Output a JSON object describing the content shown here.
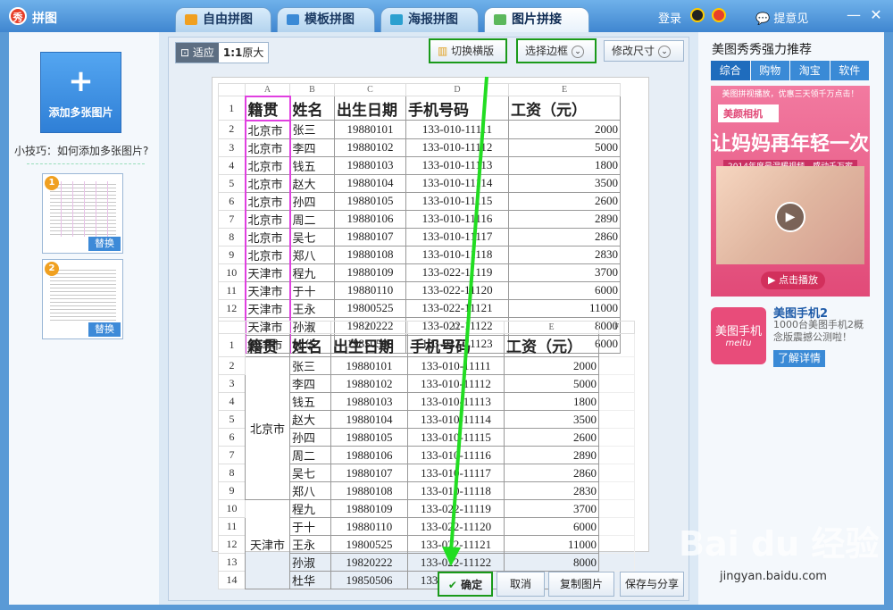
{
  "window": {
    "logo_text": "秀",
    "title": "拼图",
    "login": "登录",
    "feedback": "提意见",
    "minimize": "—",
    "close": "✕"
  },
  "tabs": [
    {
      "label": "自由拼图",
      "color": "#f0a020"
    },
    {
      "label": "模板拼图",
      "color": "#3a8ad6"
    },
    {
      "label": "海报拼图",
      "color": "#2aa0d0"
    },
    {
      "label": "图片拼接",
      "color": "#5cb85c"
    }
  ],
  "left": {
    "add_label": "添加多张图片",
    "plus": "+",
    "tip": "小技巧：如何添加多张图片?",
    "thumbs": [
      {
        "num": "1",
        "replace": "替换"
      },
      {
        "num": "2",
        "replace": "替换"
      }
    ]
  },
  "toolbar": {
    "fit": "适应",
    "ratio": "1:1",
    "original": "原大",
    "switch_layout": "切换横版",
    "select_border": "选择边框",
    "resize": "修改尺寸"
  },
  "sheet1": {
    "col_headers": [
      "A",
      "B",
      "C",
      "D",
      "E"
    ],
    "headers": [
      "籍贯",
      "姓名",
      "出生日期",
      "手机号码",
      "工资（元）"
    ],
    "rows": [
      [
        "2",
        "北京市",
        "张三",
        "19880101",
        "133-010-11111",
        "2000"
      ],
      [
        "3",
        "北京市",
        "李四",
        "19880102",
        "133-010-11112",
        "5000"
      ],
      [
        "4",
        "北京市",
        "钱五",
        "19880103",
        "133-010-11113",
        "1800"
      ],
      [
        "5",
        "北京市",
        "赵大",
        "19880104",
        "133-010-11114",
        "3500"
      ],
      [
        "6",
        "北京市",
        "孙四",
        "19880105",
        "133-010-11115",
        "2600"
      ],
      [
        "7",
        "北京市",
        "周二",
        "19880106",
        "133-010-11116",
        "2890"
      ],
      [
        "8",
        "北京市",
        "吴七",
        "19880107",
        "133-010-11117",
        "2860"
      ],
      [
        "9",
        "北京市",
        "郑八",
        "19880108",
        "133-010-11118",
        "2830"
      ],
      [
        "10",
        "天津市",
        "程九",
        "19880109",
        "133-022-11119",
        "3700"
      ],
      [
        "11",
        "天津市",
        "于十",
        "19880110",
        "133-022-11120",
        "6000"
      ],
      [
        "12",
        "天津市",
        "王永",
        "19800525",
        "133-022-11121",
        "11000"
      ],
      [
        "13",
        "天津市",
        "孙淑",
        "19820222",
        "133-022-11122",
        "8000"
      ],
      [
        "14",
        "天津市",
        "杜华",
        "19850506",
        "133-022-11123",
        "6000"
      ]
    ]
  },
  "sheet2": {
    "col_headers": [
      "A",
      "B",
      "C",
      "D",
      "E",
      "F"
    ],
    "headers": [
      "籍贯",
      "姓名",
      "出生日期",
      "手机号码",
      "工资（元）"
    ],
    "groups": [
      "北京市",
      "天津市"
    ],
    "rows": [
      [
        "2",
        "张三",
        "19880101",
        "133-010-11111",
        "2000"
      ],
      [
        "3",
        "李四",
        "19880102",
        "133-010-11112",
        "5000"
      ],
      [
        "4",
        "钱五",
        "19880103",
        "133-010-11113",
        "1800"
      ],
      [
        "5",
        "赵大",
        "19880104",
        "133-010-11114",
        "3500"
      ],
      [
        "6",
        "孙四",
        "19880105",
        "133-010-11115",
        "2600"
      ],
      [
        "7",
        "周二",
        "19880106",
        "133-010-11116",
        "2890"
      ],
      [
        "8",
        "吴七",
        "19880107",
        "133-010-11117",
        "2860"
      ],
      [
        "9",
        "郑八",
        "19880108",
        "133-010-11118",
        "2830"
      ],
      [
        "10",
        "程九",
        "19880109",
        "133-022-11119",
        "3700"
      ],
      [
        "11",
        "于十",
        "19880110",
        "133-022-11120",
        "6000"
      ],
      [
        "12",
        "王永",
        "19800525",
        "133-022-11121",
        "11000"
      ],
      [
        "13",
        "孙淑",
        "19820222",
        "133-022-11122",
        "8000"
      ],
      [
        "14",
        "杜华",
        "19850506",
        "133-022-11123",
        "6000"
      ]
    ]
  },
  "bottom": {
    "ok": "确定",
    "cancel": "取消",
    "copy": "复制图片",
    "save": "保存与分享"
  },
  "right": {
    "title": "美图秀秀强力推荐",
    "tabs": [
      "综合",
      "购物",
      "淘宝",
      "软件"
    ],
    "ad": {
      "l1": "美图拼视播放，优惠三天领千万点击！",
      "brand": "美颜相机",
      "headline": "让妈妈再年轻一次",
      "sub": "2014年度最温暖视频，感动千万家人！",
      "play_btn": "点击播放"
    },
    "phone": {
      "p1": "美图手机",
      "p2": "meitu",
      "name": "美图手机2",
      "desc": "1000台美图手机2概念版震撼公测啦！",
      "more": "了解详情"
    }
  },
  "watermark": {
    "brand": "Bai du 经验",
    "url": "jingyan.baidu.com"
  }
}
